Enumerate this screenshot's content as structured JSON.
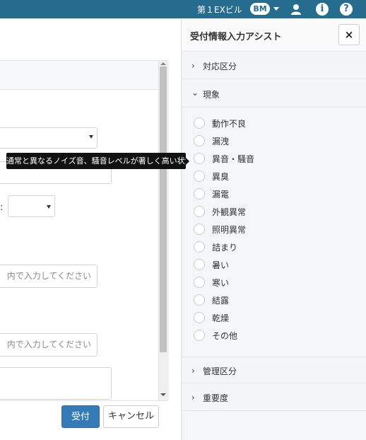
{
  "topbar": {
    "building_name": "第１EXビル",
    "user_badge": "BM"
  },
  "form": {
    "input_hint_1": "内で入力してください",
    "input_hint_2": "内で入力してください",
    "colon": ":",
    "accept_label": "受付",
    "cancel_label": "キャンセル"
  },
  "tooltip": {
    "text": "通常と異なるノイズ音、騒音レベルが著しく高い状況"
  },
  "assist_panel": {
    "title": "受付情報入力アシスト",
    "close_label": "×",
    "sections": {
      "taio": "対応区分",
      "gensho": "現象",
      "kanri": "管理区分",
      "juyodo": "重要度"
    },
    "phenomena": [
      "動作不良",
      "漏洩",
      "異音・騒音",
      "異臭",
      "漏電",
      "外観異常",
      "照明異常",
      "詰まり",
      "暑い",
      "寒い",
      "結露",
      "乾燥",
      "その他"
    ]
  },
  "colors": {
    "topbar": "#266c8f",
    "primary_button": "#337ab7"
  },
  "icons": {
    "user": "user-icon",
    "info": "info-icon",
    "help": "help-icon",
    "close": "close-icon",
    "chevron_right": "chevron-right-icon",
    "chevron_down": "chevron-down-icon"
  }
}
